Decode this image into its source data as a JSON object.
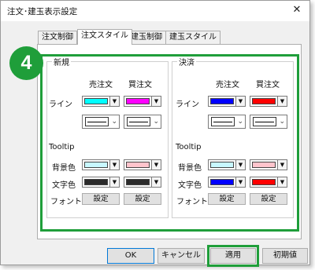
{
  "window": {
    "title": "注文･建玉表示設定",
    "close_glyph": "✕"
  },
  "tabs": [
    {
      "label": "注文制御"
    },
    {
      "label": "注文スタイル",
      "active": true
    },
    {
      "label": "建玉制御"
    },
    {
      "label": "建玉スタイル"
    }
  ],
  "step_badge": "4",
  "groups": {
    "new": {
      "title": "新規",
      "sell_header": "売注文",
      "buy_header": "買注文",
      "line_label": "ライン",
      "tooltip_label": "Tooltip",
      "bg_label": "背景色",
      "text_label": "文字色",
      "font_label": "フォント",
      "font_btn": "設定",
      "colors": {
        "line_sell": "#00ffff",
        "line_buy": "#ff00ff",
        "bg_sell": "#c8f8ff",
        "bg_buy": "#ffc4cc",
        "text_sell": "#2b2b2b",
        "text_buy": "#2b2b2b"
      }
    },
    "settle": {
      "title": "決済",
      "sell_header": "売注文",
      "buy_header": "買注文",
      "line_label": "ライン",
      "tooltip_label": "Tooltip",
      "bg_label": "背景色",
      "text_label": "文字色",
      "font_label": "フォント",
      "font_btn": "設定",
      "colors": {
        "line_sell": "#0000ff",
        "line_buy": "#ff0000",
        "bg_sell": "#c8f8ff",
        "bg_buy": "#ffc4cc",
        "text_sell": "#0000ff",
        "text_buy": "#ff0000"
      }
    }
  },
  "footer": {
    "ok": "OK",
    "cancel": "キャンセル",
    "apply": "適用",
    "reset": "初期値"
  },
  "accent_color": "#1f9e3a"
}
